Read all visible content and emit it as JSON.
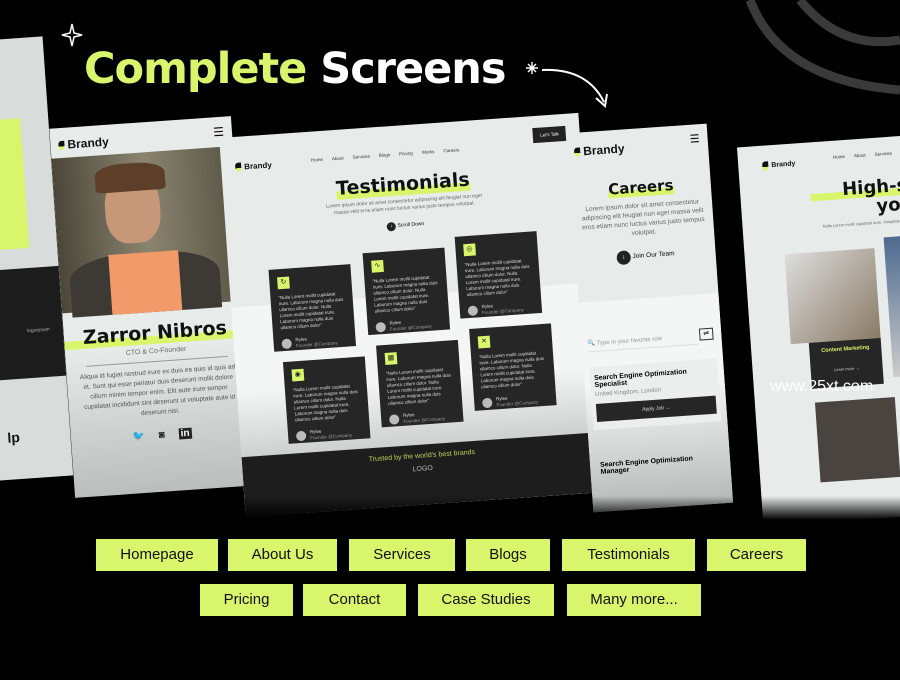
{
  "headline": {
    "part1": "Complete",
    "part2": "Screens",
    "accent": "#d9f56b"
  },
  "watermark": "www.25xt.com",
  "left_partial": {
    "text": "lp",
    "logo": "logoipsum"
  },
  "profile_screen": {
    "brand": "Brandy",
    "menu_icon": "hamburger-icon",
    "name": "Zarror Nibros",
    "role": "CTO & Co-Founder",
    "bio": "Aliqua id fugiat nostrud irure ex duis ea quis id quis ad et. Sunt qui esse pariatur duis deserunt mollit dolore cillum minim tempor enim. Elit aute irure tempor cupidatat incididunt sint deserunt ut voluptate aute id deserunt nisi.",
    "socials": [
      "twitter-icon",
      "instagram-icon",
      "linkedin-icon"
    ]
  },
  "testimonials_screen": {
    "brand": "Brandy",
    "nav": [
      "Home",
      "About",
      "Services",
      "Blogs",
      "Pricing",
      "Works",
      "Careers"
    ],
    "cta": "Let's Talk",
    "title": "Testimonials",
    "subtitle": "Lorem ipsum dolor sit amet consectetur adipiscing elit feugiat nun eget massa velit eros etiam nunc luctus varius justo tempus volutpat.",
    "scroll": "Scroll Down",
    "cards": [
      {
        "quote": "“Nulla Lorem mollit cupidatat irure. Laborum magna nulla duis ullamco cillum dolor. Nulla Lorem mollit cupidatat irure. Laborum magna nulla duis ullamco cillum dolor”",
        "name": "Rylee",
        "role": "Founder @Company"
      },
      {
        "quote": "“Nulla Lorem mollit cupidatat irure. Laborum magna nulla duis ullamco cillum dolor. Nulla Lorem mollit cupidatat irure. Laborum magna nulla duis ullamco cillum dolor”",
        "name": "Rylee",
        "role": "Founder @Company"
      },
      {
        "quote": "“Nulla Lorem mollit cupidatat irure. Laborum magna nulla duis ullamco cillum dolor. Nulla Lorem mollit cupidatat irure. Laborum magna nulla duis ullamco cillum dolor”",
        "name": "Rylee",
        "role": "Founder @Company"
      },
      {
        "quote": "“Nulla Lorem mollit cupidatat irure. Laborum magna nulla duis ullamco cillum dolor. Nulla Lorem mollit cupidatat irure. Laborum magna nulla duis ullamco cillum dolor”",
        "name": "Rylee",
        "role": "Founder @Company"
      },
      {
        "quote": "“Nulla Lorem mollit cupidatat irure. Laborum magna nulla duis ullamco cillum dolor. Nulla Lorem mollit cupidatat irure. Laborum magna nulla duis ullamco cillum dolor”",
        "name": "Rylee",
        "role": "Founder @Company"
      },
      {
        "quote": "“Nulla Lorem mollit cupidatat irure. Laborum magna nulla duis ullamco cillum dolor. Nulla Lorem mollit cupidatat irure. Laborum magna nulla duis ullamco cillum dolor”",
        "name": "Rylee",
        "role": "Founder @Company"
      }
    ],
    "trusted": "Trusted by the world's best brands",
    "logo": "LOGO",
    "brand_logo": "logoipsum"
  },
  "careers_screen": {
    "brand": "Brandy",
    "title": "Careers",
    "subtitle": "Lorem ipsum dolor sit amet consectetur adipiscing elit feugiat nun eget massa velit eros etiam nunc luctus varius justo tempus volutpat.",
    "cta": "Join Our Team",
    "search_placeholder": "Type in your favorite role",
    "jobs": [
      {
        "title": "Search Engine Optimization Specialist",
        "location": "United Kingdom, London",
        "apply": "Apply Job →"
      },
      {
        "title": "Search Engine Optimization Manager"
      }
    ]
  },
  "services_screen": {
    "brand": "Brandy",
    "nav": [
      "Home",
      "About",
      "Services"
    ],
    "title1": "High-serv",
    "title2": "your b",
    "subtitle": "Nulla Lorem mollit cupidatat irure. Voluptate exercitation incididunt",
    "card_title": "Content Marketing",
    "card_link": "Learn more →"
  },
  "pages": [
    "Homepage",
    "About Us",
    "Services",
    "Blogs",
    "Testimonials",
    "Careers",
    "Pricing",
    "Contact",
    "Case Studies",
    "Many more..."
  ]
}
